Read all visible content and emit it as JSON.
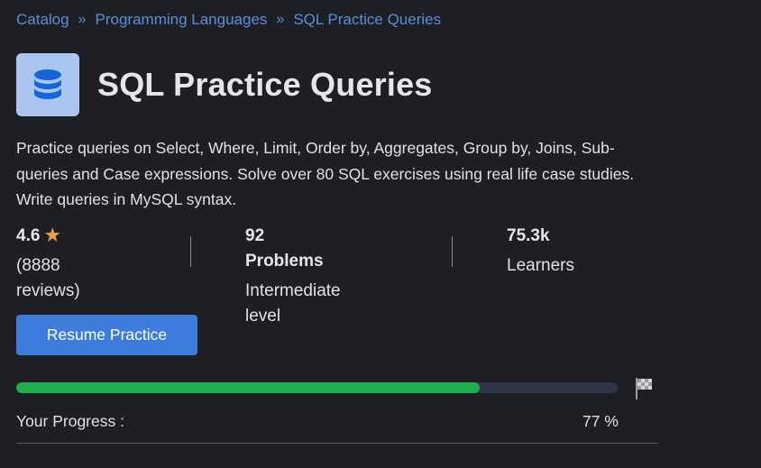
{
  "breadcrumb": {
    "items": [
      "Catalog",
      "Programming Languages",
      "SQL Practice Queries"
    ],
    "separator": "»"
  },
  "course": {
    "icon": "database-icon",
    "title": "SQL Practice Queries",
    "description": "Practice queries on Select, Where, Limit, Order by, Aggregates, Group by, Joins, Sub-queries and Case expressions. Solve over 80 SQL exercises using real life case studies. Write queries in MySQL syntax."
  },
  "stats": {
    "rating": "4.6",
    "star": "★",
    "reviews": "(8888 reviews)",
    "problems": "92 Problems",
    "level": "Intermediate level",
    "learners_count": "75.3k",
    "learners_label": "Learners"
  },
  "actions": {
    "resume_label": "Resume Practice"
  },
  "progress": {
    "label": "Your Progress :",
    "percent_text": "77 %",
    "value": 0.77
  },
  "colors": {
    "accent": "#3d7bdc",
    "progress": "#1eae4d",
    "star": "#e8a33d",
    "link": "#5a8fd8"
  }
}
